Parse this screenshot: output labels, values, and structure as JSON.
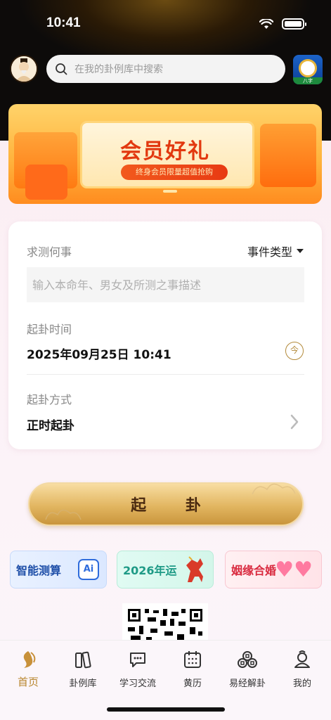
{
  "status_bar": {
    "time": "10:41"
  },
  "header": {
    "search_placeholder": "在我的卦例库中搜索",
    "app_icon_caption": "八字"
  },
  "banner": {
    "title": "会员好礼",
    "subtitle": "终身会员限量超值抢购"
  },
  "form": {
    "question_label": "求测何事",
    "event_type": "事件类型",
    "description_placeholder": "输入本命年、男女及所测之事描述",
    "time_label": "起卦时间",
    "time_value": "2025年09月25日 10:41",
    "now_button": "今",
    "method_label": "起卦方式",
    "method_value": "正时起卦"
  },
  "primary_button": "起 卦",
  "quick_links": {
    "ai": "智能测算",
    "year": "2026年运",
    "marriage": "姻缘合婚"
  },
  "tabs": [
    {
      "label": "首页"
    },
    {
      "label": "卦例库"
    },
    {
      "label": "学习交流"
    },
    {
      "label": "黄历"
    },
    {
      "label": "易经解卦"
    },
    {
      "label": "我的"
    }
  ],
  "colors": {
    "accent_gold": "#b8862e",
    "banner_red": "#e2380f",
    "background_pink": "#fbf1f6"
  }
}
